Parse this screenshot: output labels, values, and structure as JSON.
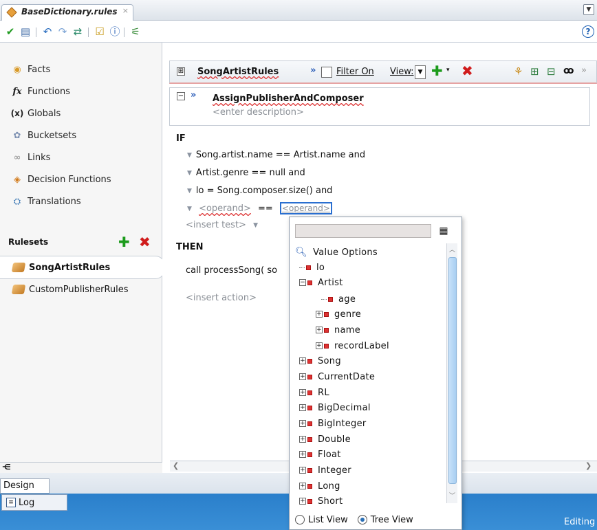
{
  "tab": {
    "title": "BaseDictionary.rules",
    "close": "×"
  },
  "toolbar": {
    "help": "?"
  },
  "sidebar": {
    "items": [
      {
        "label": "Facts"
      },
      {
        "label": "Functions"
      },
      {
        "label": "Globals"
      },
      {
        "label": "Bucketsets"
      },
      {
        "label": "Links"
      },
      {
        "label": "Decision Functions"
      },
      {
        "label": "Translations"
      }
    ],
    "rulesets_header": "Rulesets",
    "rulesets": [
      {
        "label": "SongArtistRules",
        "selected": true
      },
      {
        "label": "CustomPublisherRules",
        "selected": false
      }
    ]
  },
  "ruleset_bar": {
    "name": "SongArtistRules",
    "filter_label": "Filter On",
    "view_label": "View:"
  },
  "rule": {
    "name": "AssignPublisherAndComposer",
    "description_placeholder": "<enter description>"
  },
  "editor": {
    "if_kw": "IF",
    "conditions": [
      "Song.artist.name  ==  Artist.name and",
      "Artist.genre  ==  null and",
      "lo = Song.composer.size() and"
    ],
    "operand_left": "<operand>",
    "operand_eq": "==",
    "operand_right": "<operand>",
    "insert_test": "<insert test>",
    "then_kw": "THEN",
    "action": "call processSong( so",
    "insert_action": "<insert action>"
  },
  "popup": {
    "header": "Value Options",
    "nodes": [
      {
        "label": "lo"
      },
      {
        "label": "Artist"
      },
      {
        "label": "age"
      },
      {
        "label": "genre"
      },
      {
        "label": "name"
      },
      {
        "label": "recordLabel"
      },
      {
        "label": "Song"
      },
      {
        "label": "CurrentDate"
      },
      {
        "label": "RL"
      },
      {
        "label": "BigDecimal"
      },
      {
        "label": "BigInteger"
      },
      {
        "label": "Double"
      },
      {
        "label": "Float"
      },
      {
        "label": "Integer"
      },
      {
        "label": "Long"
      },
      {
        "label": "Short"
      }
    ],
    "list_view": "List View",
    "tree_view": "Tree View",
    "selected_view": "Tree View"
  },
  "bottom": {
    "design_tab": "Design",
    "log_tab": "Log",
    "status": "Editing"
  },
  "colors": {
    "accent": "#2a7fcb",
    "delete": "#d01c1c",
    "add": "#1c9b1c"
  }
}
